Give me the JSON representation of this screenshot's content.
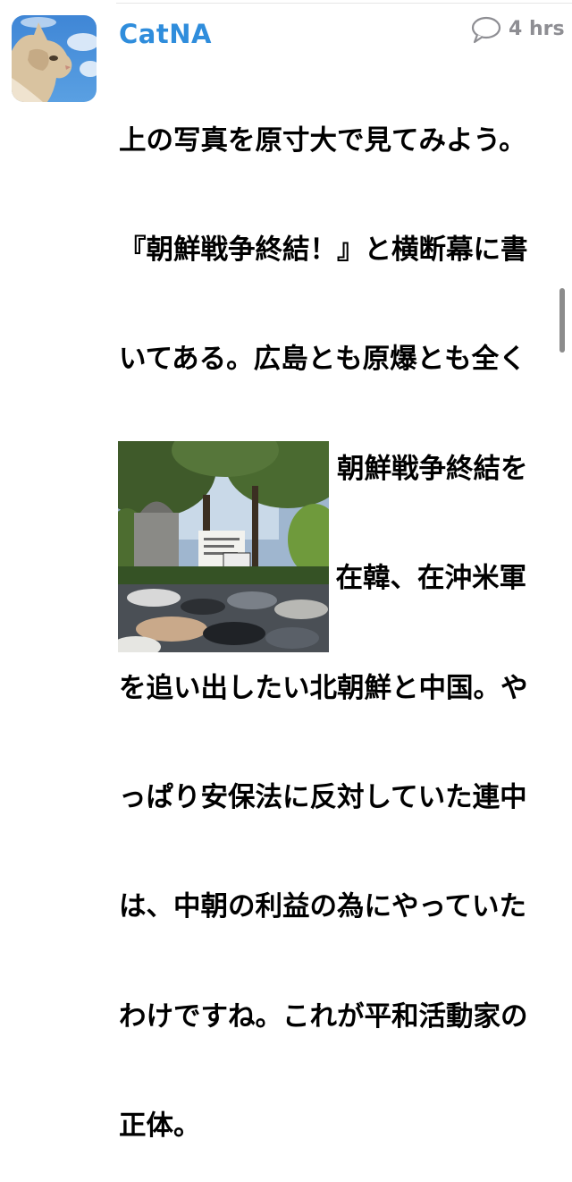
{
  "post": {
    "username": "CatNA",
    "timestamp": "4 hrs",
    "body_lines": [
      "上の写真を原寸大で見てみよう。",
      "『朝鮮戦争終結！』と横断幕に書",
      "いてある。広島とも原爆とも全く",
      "関係がない。今、朝鮮戦争終結を",
      "望んでいるのは、在韓、在沖米軍",
      "を追い出したい北朝鮮と中国。や",
      "っぱり安保法に反対していた連中",
      "は、中朝の利益の為にやっていた",
      "わけですね。これが平和活動家の",
      "正体。"
    ]
  },
  "icons": {
    "comment": "comment-bubble-icon"
  },
  "colors": {
    "username": "#2f8ddc",
    "timestamp": "#8e8e93",
    "text": "#000000"
  }
}
